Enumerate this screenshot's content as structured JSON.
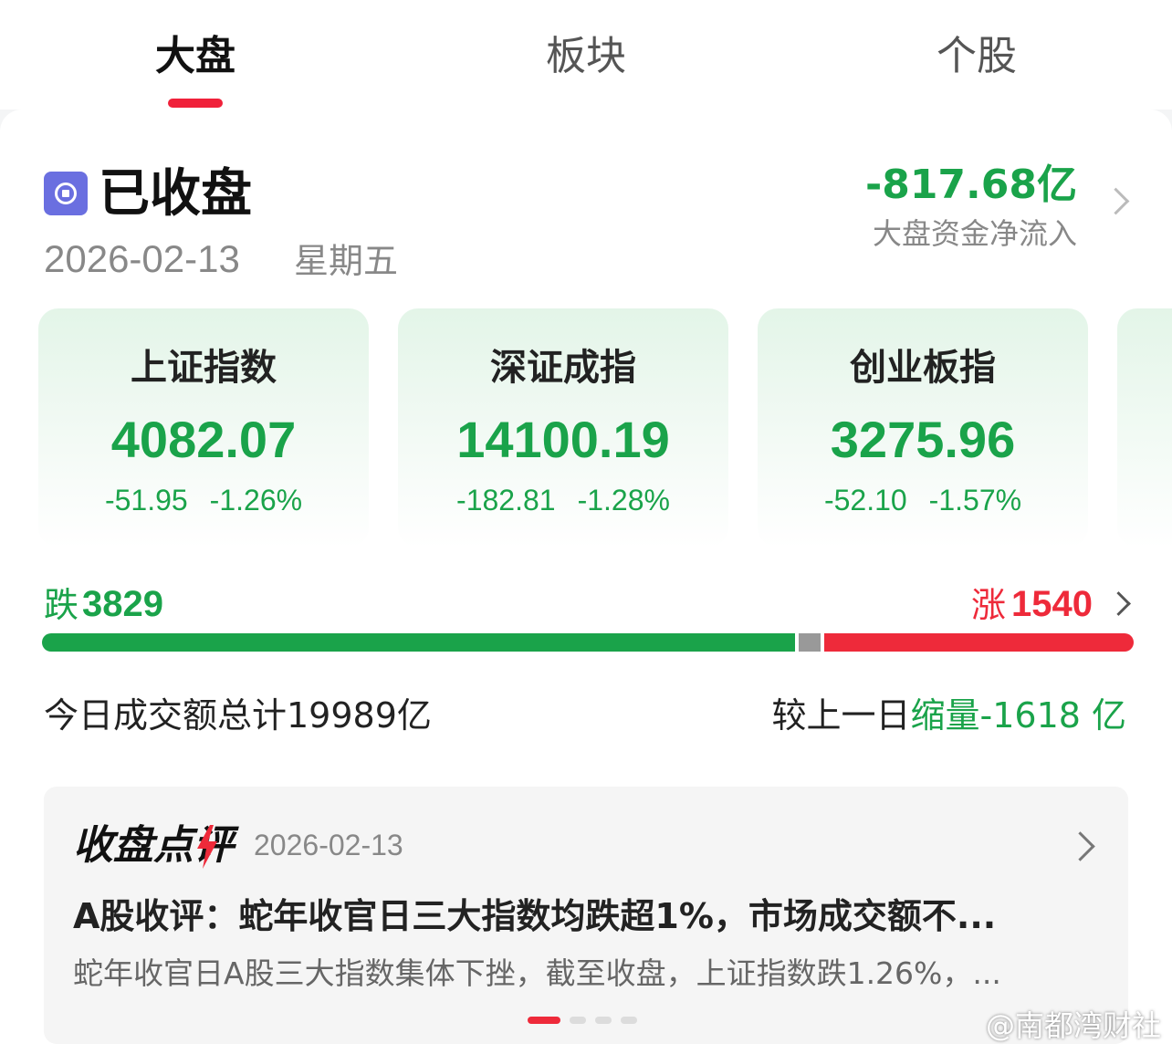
{
  "tabs": [
    {
      "label": "大盘",
      "active": true
    },
    {
      "label": "板块",
      "active": false
    },
    {
      "label": "个股",
      "active": false
    }
  ],
  "status": {
    "label": "已收盘",
    "date": "2026-02-13",
    "weekday": "星期五",
    "icon": "stop-circle-icon"
  },
  "capital_flow": {
    "value": "-817.68亿",
    "label": "大盘资金净流入"
  },
  "indices": [
    {
      "name": "上证指数",
      "value": "4082.07",
      "change": "-51.95",
      "change_pct": "-1.26%"
    },
    {
      "name": "深证成指",
      "value": "14100.19",
      "change": "-182.81",
      "change_pct": "-1.28%"
    },
    {
      "name": "创业板指",
      "value": "3275.96",
      "change": "-52.10",
      "change_pct": "-1.57%"
    }
  ],
  "breadth": {
    "fall_label": "跌",
    "fall_count": 3829,
    "rise_label": "涨",
    "rise_count": 1540,
    "fall_fraction": 0.69,
    "flat_fraction": 0.02
  },
  "turnover": {
    "total_text": "今日成交额总计19989亿",
    "compare_prefix": "较上一日",
    "compare_value": "缩量-1618 亿"
  },
  "review": {
    "title": "收盘点评",
    "date": "2026-02-13",
    "headline": "A股收评：蛇年收官日三大指数均跌超1%，市场成交额不...",
    "summary": "蛇年收官日A股三大指数集体下挫，截至收盘，上证指数跌1.26%，...",
    "page_count": 4,
    "active_page": 1
  },
  "watermark": "@南都湾财社",
  "colors": {
    "down": "#1aa34a",
    "up": "#ee2a3a",
    "accent": "#f0213a",
    "status_icon": "#6a6fe0"
  }
}
